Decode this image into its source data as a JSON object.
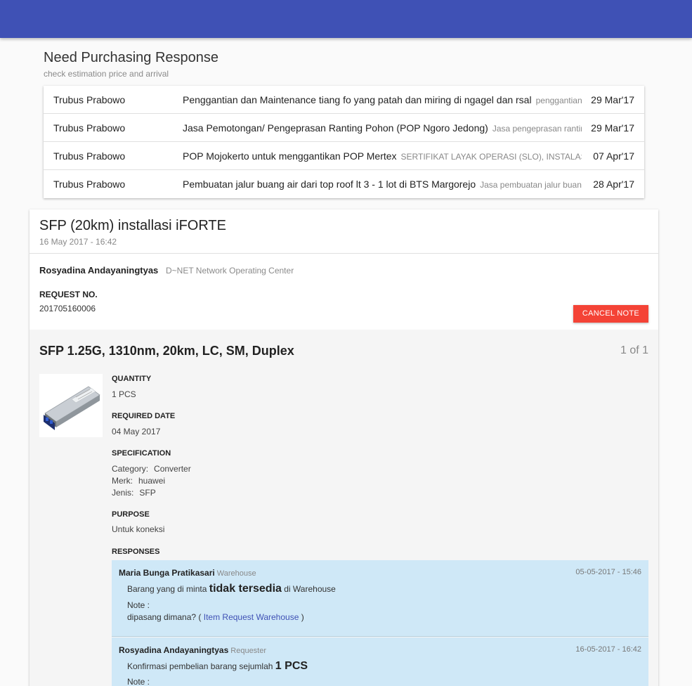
{
  "need": {
    "title": "Need Purchasing Response",
    "subtitle": "check estimation price and arrival",
    "rows": [
      {
        "name": "Trubus Prabowo",
        "desc": "Penggantian dan Maintenance tiang fo yang patah dan miring di ngagel dan rsal",
        "extra": "penggantian tiang",
        "date": "29 Mar'17"
      },
      {
        "name": "Trubus Prabowo",
        "desc": "Jasa Pemotongan/ Pengeprasan Ranting Pohon (POP Ngoro Jedong)",
        "extra": "Jasa pengeprasan ranting",
        "date": "29 Mar'17"
      },
      {
        "name": "Trubus Prabowo",
        "desc": "POP Mojokerto untuk menggantikan POP Mertex",
        "extra": "SERTIFIKAT LAYAK OPERASI (SLO), INSTALASI LISTRIK",
        "date": "07 Apr'17"
      },
      {
        "name": "Trubus Prabowo",
        "desc": "Pembuatan jalur buang air dari top roof lt 3 - 1 lot di BTS Margorejo",
        "extra": "Jasa pembuatan jalur buang",
        "date": "28 Apr'17"
      }
    ]
  },
  "request": {
    "title": "SFP (20km) installasi iFORTE",
    "date": "16 May 2017 - 16:42",
    "requester": "Rosyadina Andayaningtyas",
    "org": "D~NET Network Operating Center",
    "request_no_label": "REQUEST NO.",
    "request_no": "201705160006",
    "cancel_label": "CANCEL NOTE"
  },
  "item": {
    "title": "SFP 1.25G, 1310nm, 20km, LC, SM, Duplex",
    "count": "1 of 1",
    "quantity_label": "QUANTITY",
    "quantity": "1 PCS",
    "required_date_label": "REQUIRED DATE",
    "required_date": "04 May 2017",
    "spec_label": "SPECIFICATION",
    "spec": [
      {
        "k": "Category:",
        "v": "Converter"
      },
      {
        "k": "Merk:",
        "v": "huawei"
      },
      {
        "k": "Jenis:",
        "v": "SFP"
      }
    ],
    "purpose_label": "PURPOSE",
    "purpose": "Untuk koneksi",
    "responses_label": "RESPONSES"
  },
  "responses": [
    {
      "name": "Maria Bunga Pratikasari",
      "role": "Warehouse",
      "time": "05-05-2017 - 15:46",
      "msg_pre": "Barang yang di minta",
      "msg_big": "tidak tersedia",
      "msg_post": "di Warehouse",
      "note_label": "Note :",
      "note_pre": "dipasang dimana? (",
      "note_link": "Item Request Warehouse",
      "note_post": ")"
    },
    {
      "name": "Rosyadina Andayaningtyas",
      "role": "Requester",
      "time": "16-05-2017 - 16:42",
      "msg_pre": "Konfirmasi pembelian barang sejumlah",
      "msg_big": "1 PCS",
      "note_label": "Note :"
    }
  ]
}
